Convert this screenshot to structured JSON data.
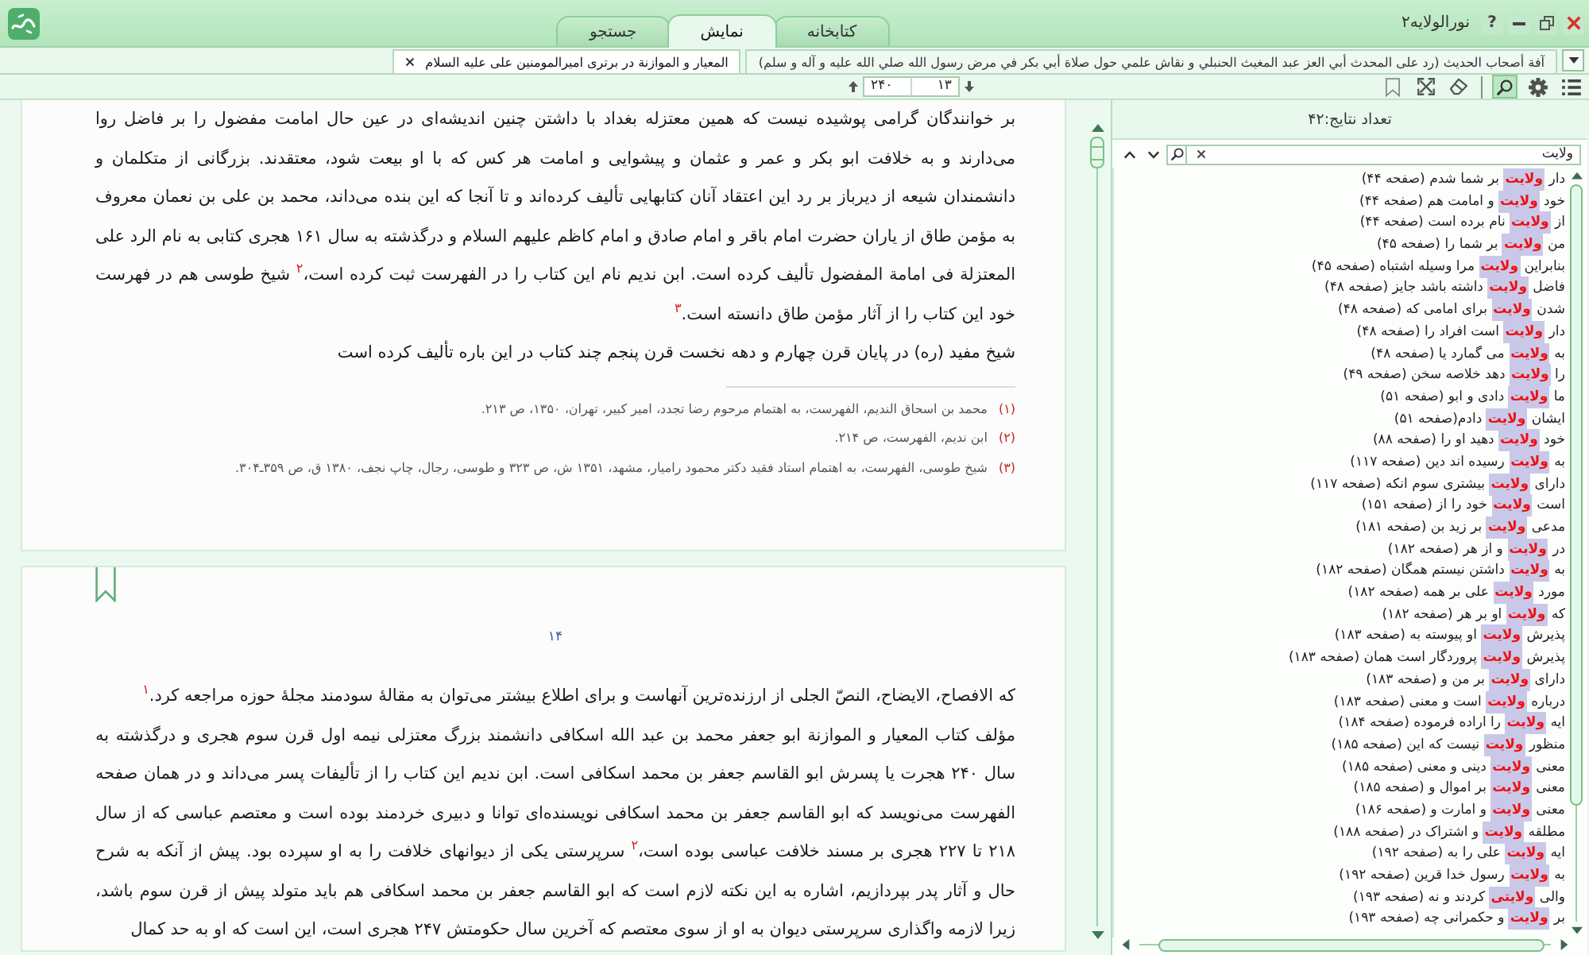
{
  "titlebar": {
    "title": "نورالولایه۲",
    "help": "?"
  },
  "main_tabs": [
    {
      "label": "کتابخانه",
      "selected": false
    },
    {
      "label": "نمایش",
      "selected": true
    },
    {
      "label": "جستجو",
      "selected": false
    }
  ],
  "document_tabs": [
    {
      "title": "آفة أصحاب الحديث (رد على المحدث أبي العز عبد المغيث الحنبلي و نقاش علمي حول صلاة أبي بكر في مرض رسول الله صلي الله عليه و آله و سلم)",
      "selected": false
    },
    {
      "title": "المعیار و الموازنة در برتری امیرالمومنین علی علیه السلام",
      "selected": true
    }
  ],
  "toolbar": {
    "main_tools": [
      {
        "kind": "list",
        "selected": false
      },
      {
        "kind": "settings",
        "selected": false
      },
      {
        "kind": "search",
        "selected": true
      }
    ],
    "view_tools": [
      {
        "kind": "eraser",
        "selected": false
      },
      {
        "kind": "expand",
        "selected": false
      },
      {
        "kind": "bookmark",
        "selected": false
      }
    ],
    "current_page": "۱۳",
    "page_count": "۲۴۰"
  },
  "pages": [
    {
      "paragraphs": [
        "بر خوانندگان گرامی پوشیده نیست که همین معتزله بغداد با داشتن چنین اندیشه‌ای در عین حال امامت مفضول را بر فاضل روا می‌دارند و به خلافت ابو بکر و عمر و عثمان و پیشوایی و امامت هر کس که با او بیعت شود، معتقدند. بزرگانی از متکلمان و دانشمندان شیعه از دیرباز بر رد این اعتقاد آنان کتابهایی تألیف کرده‌اند و تا آنجا که این بنده می‌داند، محمد بن علی بن نعمان معروف به مؤمن طاق از یاران حضرت امام باقر و امام صادق و امام کاظم علیهم السلام و درگذشته به سال ۱۶۱ هجری کتابی به نام الرد علی المعتزلة فی امامة المفضول تألیف کرده است. ابن ندیم نام این کتاب را در الفهرست ثبت کرده است،$^{۲}$ شیخ طوسی هم در فهرست خود این کتاب را از آثار مؤمن طاق دانسته است.$^{۳}$",
        "شیخ مفید (ره) در پایان قرن چهارم و دهه نخست قرن پنجم چند کتاب در این باره تألیف کرده است"
      ],
      "footnotes": [
        {
          "number": "(۱)",
          "text": "محمد بن اسحاق الندیم، الفهرست، به اهتمام مرحوم رضا تجدد، امیر کبیر، تهران، ۱۳۵۰، ص ۲۱۳."
        },
        {
          "number": "(۲)",
          "text": "ابن ندیم، الفهرست، ص ۲۱۴."
        },
        {
          "number": "(۳)",
          "text": "شیخ طوسی، الفهرست، به اهتمام استاد فقید دکتر محمود رامیار، مشهد، ۱۳۵۱ ش، ص ۳۲۳ و طوسی، رجال، چاپ نجف، ۱۳۸۰ ق، ص ۳۵۹ـ۳۰۴."
        }
      ]
    },
    {
      "page_number": "۱۴",
      "paragraphs": [
        "که الافصاح، الایضاح، النصّ الجلی از ارزنده‌ترین آنهاست و برای اطلاع بیشتر می‌توان به مقالهٔ سودمند مجلهٔ حوزه مراجعه کرد.$^{۱}$",
        "مؤلف کتاب المعیار و الموازنة ابو جعفر محمد بن عبد الله اسکافی دانشمند بزرگ معتزلی نیمه اول قرن سوم هجری و درگذشته به سال ۲۴۰ هجرت یا پسرش ابو القاسم جعفر بن محمد اسکافی است. ابن ندیم این کتاب را از تألیفات پسر می‌داند و در همان صفحه الفهرست می‌نویسد که ابو القاسم جعفر بن محمد اسکافی نویسنده‌ای توانا و دبیری خردمند بوده است و معتصم عباسی که از سال ۲۱۸ تا ۲۲۷ هجری بر مسند خلافت عباسی بوده است،$^{۲}$ سرپرستی یکی از دیوانهای خلافت را به او سپرده بود. پیش از آنکه به شرح حال و آثار پدر بپردازیم، اشاره به این نکته لازم است که ابو القاسم جعفر بن محمد اسکافی هم باید متولد پیش از قرن سوم باشد، زیرا لازمه واگذاری سرپرستی دیوان به او از سوی معتصم که آخرین سال حکومتش ۲۴۷ هجری است، این است که او به حد کمال"
      ]
    }
  ],
  "results": {
    "count_label": "تعداد نتایج:۴۲",
    "query": "ولایت",
    "items": [
      "دار **ولایت** بر شما شدم (صفحه ۴۴)",
      "خود **ولایت** و امامت هم (صفحه ۴۴)",
      "از **ولایت** نام برده است (صفحه ۴۴)",
      "من **ولایت** بر شما را (صفحه ۴۵)",
      "بنابراین **ولایت** مرا وسیله اشتباه (صفحه ۴۵)",
      "فاضل **ولایت** داشته باشد جایز (صفحه ۴۸)",
      "شدن **ولایت** برای امامی که (صفحه ۴۸)",
      "دار **ولایت** است افراد را (صفحه ۴۸)",
      "به **ولایت** می گمارد یا (صفحه ۴۸)",
      "را **ولایت** دهد خلاصه سخن (صفحه ۴۹)",
      "ما **ولایت** دادی و ابو (صفحه ۵۱)",
      "ایشان **ولایت** دادم(صفحه ۵۱)",
      "خود **ولایت** دهید او را (صفحه ۸۸)",
      "به **ولایت** رسیده اند دین (صفحه ۱۱۷)",
      "دارای **ولایت** بیشتری سوم انکه (صفحه ۱۱۷)",
      "است **ولایت** خود را از (صفحه ۱۵۱)",
      "مدعی **ولایت** بر زید بن (صفحه ۱۸۱)",
      "در **ولایت** و از هر (صفحه ۱۸۲)",
      "به **ولایت** داشتن نیستم همگان (صفحه ۱۸۲)",
      "مورد **ولایت** علی بر همه (صفحه ۱۸۲)",
      "که **ولایت** او بر هر (صفحه ۱۸۲)",
      "پذیرش **ولایت** او پیوسته به (صفحه ۱۸۳)",
      "پذیرش **ولایت** پروردگار است همان (صفحه ۱۸۳)",
      "دارای **ولایت** بر من و (صفحه ۱۸۳)",
      "درباره **ولایت** است و معنی (صفحه ۱۸۳)",
      "ایه **ولایت** را اراده فرموده (صفحه ۱۸۴)",
      "منظور **ولایت** نیست که این (صفحه ۱۸۵)",
      "معنی **ولایت** دینی و معنی (صفحه ۱۸۵)",
      "معنی **ولایت** بر اموال و (صفحه ۱۸۵)",
      "معنی **ولایت** و امارت و (صفحه ۱۸۶)",
      "مطلقه **ولایت** و اشتراک در (صفحه ۱۸۸)",
      "ایه **ولایت** علی را به (صفحه ۱۹۲)",
      "به **ولایت** رسول خدا قرین (صفحه ۱۹۲)",
      "والی **ولایتی** کردند و نه (صفحه ۱۹۳)",
      "بر **ولایت** و حکمرانی چه (صفحه ۱۹۳)"
    ]
  }
}
